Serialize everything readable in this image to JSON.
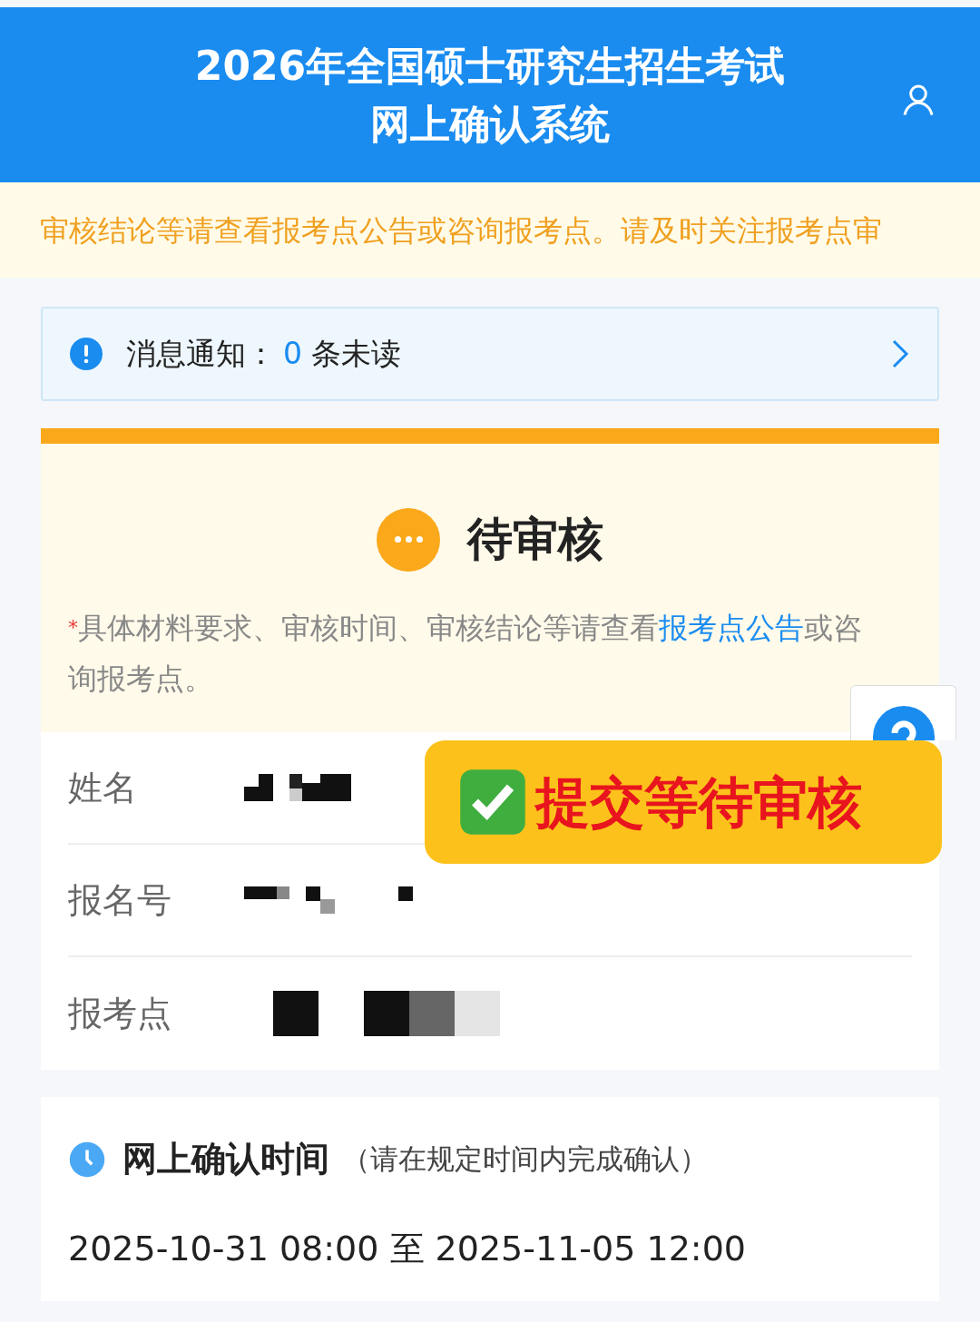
{
  "header": {
    "title_line_1": "2026年全国硕士研究生招生考试",
    "title_line_2": "网上确认系统"
  },
  "banner": {
    "text": "审核结论等请查看报考点公告或咨询报考点。请及时关注报考点审"
  },
  "notice": {
    "label": "消息通知：",
    "count": "0",
    "suffix": "条未读"
  },
  "status": {
    "title": "待审核",
    "note_marker": "*",
    "note_before": "具体材料要求、审核时间、审核结论等请查看",
    "link": "报考点公告",
    "note_after": "或咨询报考点。"
  },
  "info_rows": [
    {
      "label": "姓名"
    },
    {
      "label": "报名号"
    },
    {
      "label": "报考点"
    }
  ],
  "sticker": {
    "text": "提交等待审核"
  },
  "confirm_time": {
    "title": "网上确认时间",
    "hint": "（请在规定时间内完成确认）",
    "range": "2025-10-31 08:00 至 2025-11-05 12:00"
  }
}
